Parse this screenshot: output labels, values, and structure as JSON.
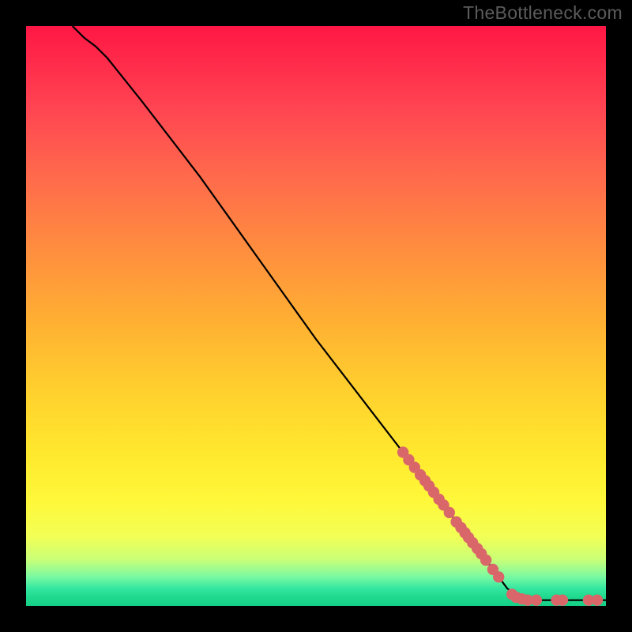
{
  "watermark": "TheBottleneck.com",
  "colors": {
    "dot": "#d9676a",
    "line": "#000000",
    "bg_top": "#ff1744",
    "bg_bottom": "#14cf86"
  },
  "chart_data": {
    "type": "line",
    "title": "",
    "xlabel": "",
    "ylabel": "",
    "xlim": [
      0,
      100
    ],
    "ylim": [
      0,
      100
    ],
    "grid": false,
    "legend": false,
    "curve": [
      {
        "x": 8,
        "y": 100
      },
      {
        "x": 10,
        "y": 98
      },
      {
        "x": 12,
        "y": 96.5
      },
      {
        "x": 14,
        "y": 94.5
      },
      {
        "x": 16,
        "y": 92
      },
      {
        "x": 20,
        "y": 87
      },
      {
        "x": 25,
        "y": 80.5
      },
      {
        "x": 30,
        "y": 74
      },
      {
        "x": 35,
        "y": 67
      },
      {
        "x": 40,
        "y": 60
      },
      {
        "x": 45,
        "y": 53
      },
      {
        "x": 50,
        "y": 46
      },
      {
        "x": 55,
        "y": 39.5
      },
      {
        "x": 60,
        "y": 33
      },
      {
        "x": 65,
        "y": 26.5
      },
      {
        "x": 70,
        "y": 20
      },
      {
        "x": 75,
        "y": 13.5
      },
      {
        "x": 80,
        "y": 7
      },
      {
        "x": 83,
        "y": 3
      },
      {
        "x": 85,
        "y": 1.5
      },
      {
        "x": 87,
        "y": 1
      },
      {
        "x": 90,
        "y": 1
      },
      {
        "x": 95,
        "y": 1
      },
      {
        "x": 100,
        "y": 1
      }
    ],
    "points": [
      {
        "x": 65,
        "y": 26.5
      },
      {
        "x": 66,
        "y": 25.2
      },
      {
        "x": 67,
        "y": 23.9
      },
      {
        "x": 68,
        "y": 22.6
      },
      {
        "x": 68.8,
        "y": 21.6
      },
      {
        "x": 69.5,
        "y": 20.7
      },
      {
        "x": 70.3,
        "y": 19.6
      },
      {
        "x": 71.2,
        "y": 18.4
      },
      {
        "x": 72,
        "y": 17.4
      },
      {
        "x": 73,
        "y": 16.1
      },
      {
        "x": 74.2,
        "y": 14.5
      },
      {
        "x": 75,
        "y": 13.5
      },
      {
        "x": 75.7,
        "y": 12.6
      },
      {
        "x": 76.3,
        "y": 11.8
      },
      {
        "x": 77,
        "y": 10.9
      },
      {
        "x": 77.8,
        "y": 9.9
      },
      {
        "x": 78.5,
        "y": 9
      },
      {
        "x": 79.3,
        "y": 7.9
      },
      {
        "x": 80.5,
        "y": 6.3
      },
      {
        "x": 81.5,
        "y": 5
      },
      {
        "x": 83.8,
        "y": 2
      },
      {
        "x": 84.5,
        "y": 1.5
      },
      {
        "x": 85.5,
        "y": 1.2
      },
      {
        "x": 86.5,
        "y": 1
      },
      {
        "x": 88,
        "y": 1
      },
      {
        "x": 91.5,
        "y": 1
      },
      {
        "x": 92.5,
        "y": 1
      },
      {
        "x": 97,
        "y": 1
      },
      {
        "x": 98.5,
        "y": 1
      }
    ]
  }
}
